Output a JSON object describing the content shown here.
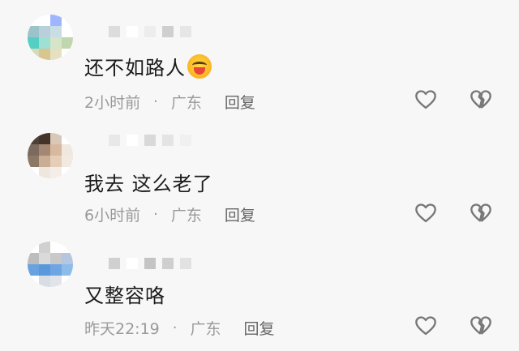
{
  "comments": [
    {
      "text": "还不如路人",
      "has_emoji": true,
      "emoji_icon": "laughing-crying-emoji",
      "time": "2小时前",
      "location": "广东",
      "reply_label": "回复",
      "avatar_colors": [
        "#ffffff",
        "#ffffff",
        "#9fb6ff",
        "#ffffff",
        "#9ac4c9",
        "#b9cfd9",
        "#c9dde6",
        "#ffffff",
        "#55cfc4",
        "#9ee0d3",
        "#d6e4c7",
        "#c0d7ad",
        "#d7d9b9",
        "#d9c58e",
        "#e6e0c3",
        "#ffffff"
      ],
      "username_mosaic": [
        "#dcdcdc",
        "#ffffff",
        "#ededed",
        "#cfcfcf",
        "#e6e6e6"
      ]
    },
    {
      "text": "我去 这么老了",
      "has_emoji": false,
      "time": "6小时前",
      "location": "广东",
      "reply_label": "回复",
      "avatar_colors": [
        "#4e4036",
        "#433328",
        "#d9c8b8",
        "#ffffff",
        "#7b6a5d",
        "#a58874",
        "#d9b8a0",
        "#f0e7df",
        "#8d7765",
        "#c9ad95",
        "#e5cdb7",
        "#f2e9e1",
        "#ffffff",
        "#efe6de",
        "#f5eee8",
        "#ffffff"
      ],
      "username_mosaic": [
        "#e8e8e8",
        "#ffffff",
        "#d9d9d9",
        "#e4e4e4",
        "#f0f0f0"
      ]
    },
    {
      "text": "又整容咯",
      "has_emoji": false,
      "time": "昨天22:19",
      "location": "广东",
      "reply_label": "回复",
      "avatar_colors": [
        "#ffffff",
        "#d0d0d0",
        "#ffffff",
        "#ffffff",
        "#bdbdbd",
        "#dadada",
        "#c9c9c9",
        "#b5c6e0",
        "#6aa2df",
        "#5a98dc",
        "#6ea6e4",
        "#8ebce8",
        "#ffffff",
        "#d7dde3",
        "#e1e5ea",
        "#ffffff"
      ],
      "username_mosaic": [
        "#d0d0d0",
        "#ffffff",
        "#c4c4c4",
        "#cfcfcf",
        "#e2e2e2"
      ]
    }
  ],
  "icons": {
    "like": "heart-outline-icon",
    "dislike": "broken-heart-outline-icon"
  },
  "colors": {
    "background": "#f7f7f7",
    "text": "#1a1a1a",
    "meta": "#9a9a9a",
    "icon": "#777777"
  }
}
